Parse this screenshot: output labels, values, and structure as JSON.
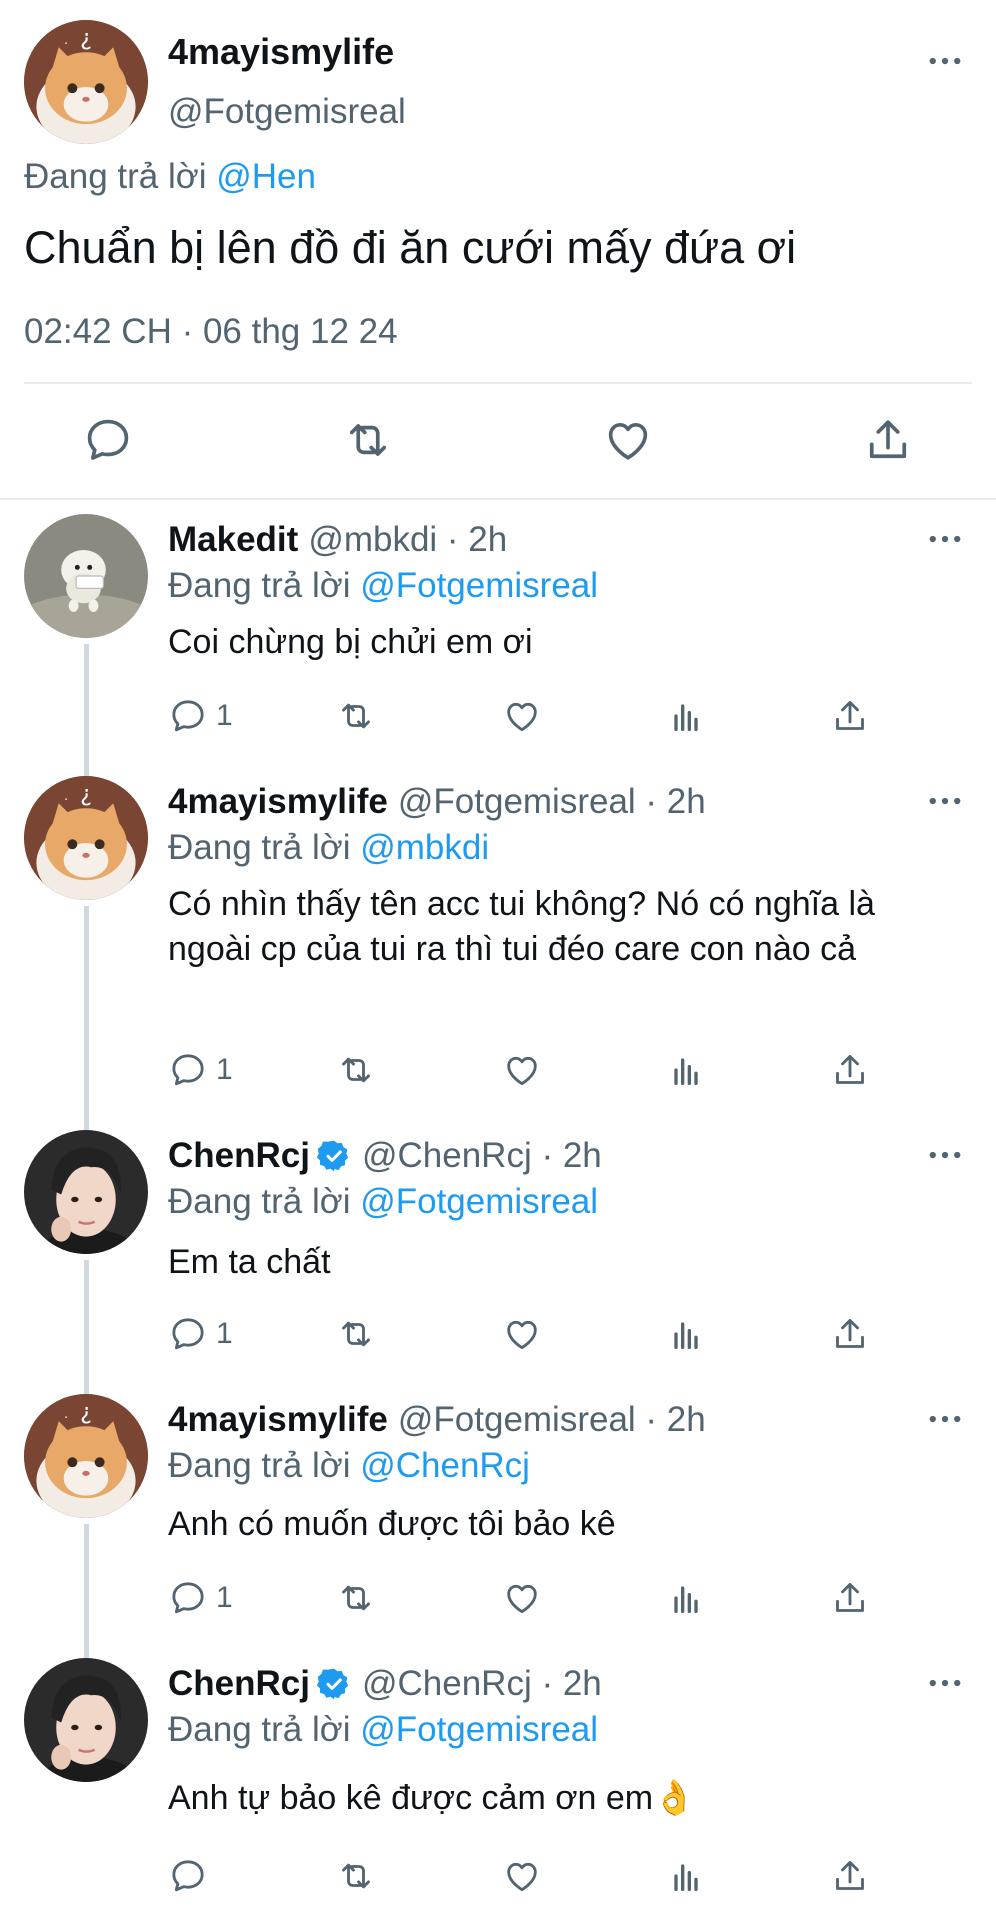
{
  "main_tweet": {
    "display_name": "4mayismylife",
    "handle": "@Fotgemisreal",
    "replying_prefix": "Đang trả lời ",
    "replying_to": "@Hen",
    "text": "Chuẩn bị lên đồ đi ăn cưới mấy đứa ơi",
    "timestamp": "02:42 CH · 06 thg 12 24",
    "actions": [
      "reply-icon",
      "retweet-icon",
      "like-icon",
      "share-icon"
    ]
  },
  "replies": [
    {
      "display_name": "Makedit",
      "verified": false,
      "meta": "@mbkdi · 2h",
      "replying_prefix": "Đang trả lời ",
      "replying_to": "@Fotgemisreal",
      "text": "Coi chừng bị chửi em ơi",
      "reply_count": "1"
    },
    {
      "display_name": "4mayismylife",
      "verified": false,
      "meta": "@Fotgemisreal · 2h",
      "replying_prefix": "Đang trả lời ",
      "replying_to": "@mbkdi",
      "text": "Có nhìn thấy tên acc tui không? Nó có nghĩa là ngoài cp của tui ra thì tui đéo care con nào cả",
      "reply_count": "1"
    },
    {
      "display_name": "ChenRcj",
      "verified": true,
      "meta": "@ChenRcj · 2h",
      "replying_prefix": "Đang trả lời ",
      "replying_to": "@Fotgemisreal",
      "text": "Em ta chất",
      "reply_count": "1"
    },
    {
      "display_name": "4mayismylife",
      "verified": false,
      "meta": "@Fotgemisreal · 2h",
      "replying_prefix": "Đang trả lời ",
      "replying_to": "@ChenRcj",
      "text": "Anh có muốn được tôi bảo kê",
      "reply_count": "1"
    },
    {
      "display_name": "ChenRcj",
      "verified": true,
      "meta": "@ChenRcj · 2h",
      "replying_prefix": "Đang trả lời ",
      "replying_to": "@Fotgemisreal",
      "text": "Anh tự bảo kê được cảm ơn em👌",
      "reply_count": ""
    }
  ],
  "colors": {
    "text": "#0f1419",
    "secondary": "#536471",
    "link": "#1d9bf0",
    "divider": "#e6ecf0",
    "thread_line": "#cfd9de",
    "verified": "#1d9bf0"
  },
  "icons": {
    "more": "more-icon",
    "reply": "reply-icon",
    "retweet": "retweet-icon",
    "like": "like-icon",
    "views": "views-icon",
    "share": "share-icon",
    "verified": "verified-badge-icon"
  }
}
